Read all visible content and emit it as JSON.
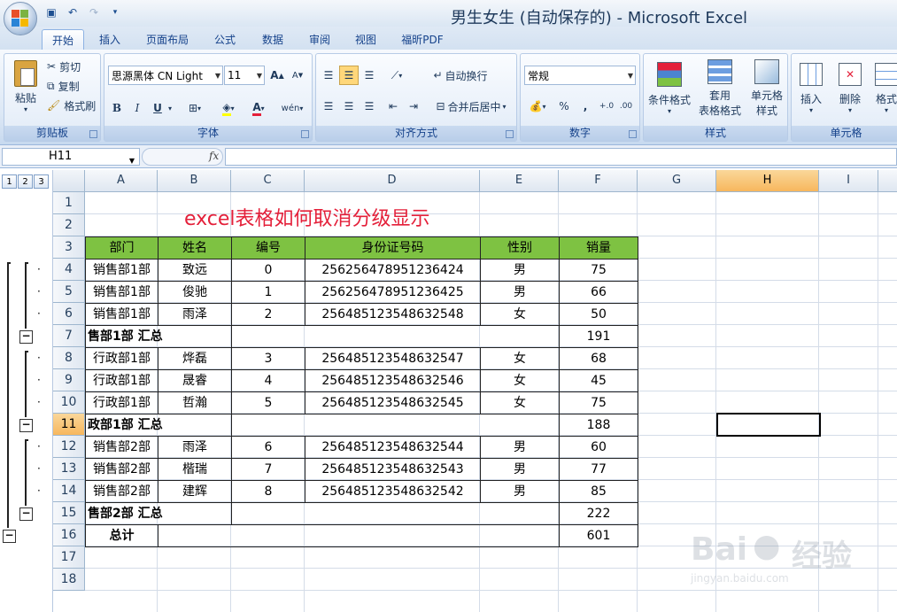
{
  "window": {
    "title": "男生女生 (自动保存的) - Microsoft Excel"
  },
  "qat": {
    "save": "save-icon",
    "undo": "undo-icon",
    "redo": "redo-icon"
  },
  "tabs": [
    "开始",
    "插入",
    "页面布局",
    "公式",
    "数据",
    "审阅",
    "视图",
    "福昕PDF"
  ],
  "ribbon": {
    "clipboard": {
      "label": "剪贴板",
      "paste": "粘贴",
      "cut": "剪切",
      "copy": "复制",
      "format_painter": "格式刷"
    },
    "font": {
      "label": "字体",
      "font_name": "思源黑体 CN Light",
      "font_size": "11",
      "bold": "B",
      "italic": "I",
      "underline": "U",
      "wen": "wén"
    },
    "alignment": {
      "label": "对齐方式",
      "wrap": "自动换行",
      "merge": "合并后居中"
    },
    "number": {
      "label": "数字",
      "format": "常规",
      "percent": "%",
      "comma": ",",
      "inc": "+.0",
      "dec": ".00"
    },
    "styles": {
      "label": "样式",
      "conditional": "条件格式",
      "table_format_1": "套用",
      "table_format_2": "表格格式",
      "cell_style_1": "单元格",
      "cell_style_2": "样式"
    },
    "cells": {
      "label": "单元格",
      "insert": "插入",
      "delete": "删除",
      "format": "格式"
    }
  },
  "formula_bar": {
    "name_box": "H11",
    "fx": "fx",
    "value": ""
  },
  "outline": {
    "levels": [
      "1",
      "2",
      "3"
    ]
  },
  "columns": [
    "A",
    "B",
    "C",
    "D",
    "E",
    "F",
    "G",
    "H",
    "I"
  ],
  "rows": [
    "1",
    "2",
    "3",
    "4",
    "5",
    "6",
    "7",
    "8",
    "9",
    "10",
    "11",
    "12",
    "13",
    "14",
    "15",
    "16",
    "17",
    "18"
  ],
  "sheet": {
    "title": "excel表格如何取消分级显示",
    "headers": [
      "部门",
      "姓名",
      "编号",
      "身份证号码",
      "性别",
      "销量"
    ],
    "data": [
      [
        "销售部1部",
        "致远",
        "0",
        "256256478951236424",
        "男",
        "75"
      ],
      [
        "销售部1部",
        "俊驰",
        "1",
        "256256478951236425",
        "男",
        "66"
      ],
      [
        "销售部1部",
        "雨泽",
        "2",
        "256485123548632548",
        "女",
        "50"
      ],
      [
        "售部1部 汇总",
        "",
        "",
        "",
        "",
        "191"
      ],
      [
        "行政部1部",
        "烨磊",
        "3",
        "256485123548632547",
        "女",
        "68"
      ],
      [
        "行政部1部",
        "晟睿",
        "4",
        "256485123548632546",
        "女",
        "45"
      ],
      [
        "行政部1部",
        "哲瀚",
        "5",
        "256485123548632545",
        "女",
        "75"
      ],
      [
        "政部1部 汇总",
        "",
        "",
        "",
        "",
        "188"
      ],
      [
        "销售部2部",
        "雨泽",
        "6",
        "256485123548632544",
        "男",
        "60"
      ],
      [
        "销售部2部",
        "楷瑞",
        "7",
        "256485123548632543",
        "男",
        "77"
      ],
      [
        "销售部2部",
        "建辉",
        "8",
        "256485123548632542",
        "男",
        "85"
      ],
      [
        "售部2部 汇总",
        "",
        "",
        "",
        "",
        "222"
      ],
      [
        "总计",
        "",
        "",
        "",
        "",
        "601"
      ]
    ]
  },
  "watermark": {
    "brand": "Bai",
    "brand2": "经验",
    "url": "jingyan.baidu.com"
  },
  "colors": {
    "header_green": "#7ec242",
    "title_red": "#e4203a",
    "selected_header": "#f7b75d"
  }
}
